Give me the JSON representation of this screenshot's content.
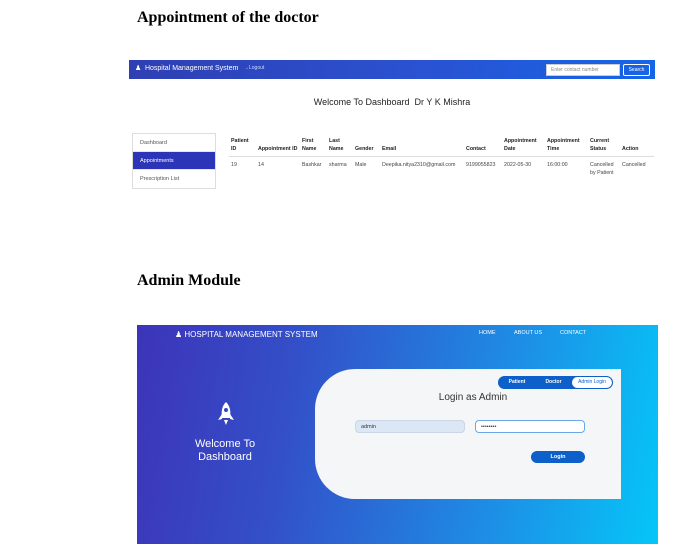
{
  "headings": {
    "doctor": "Appointment of the doctor",
    "admin": "Admin Module"
  },
  "doctor_dashboard": {
    "brand": "Hospital Management System",
    "logout": "Logout",
    "search_placeholder": "Enter contact number",
    "search_button": "Search",
    "welcome": "Welcome To Dashboard  Dr Y K Mishra",
    "sidebar": [
      {
        "label": "Dashboard",
        "active": false
      },
      {
        "label": "Appointments",
        "active": true
      },
      {
        "label": "Prescription List",
        "active": false
      }
    ],
    "table": {
      "headers": [
        "Patient ID",
        "Appointment ID",
        "First Name",
        "Last Name",
        "Gender",
        "Email",
        "Contact",
        "Appointment Date",
        "Appointment Time",
        "Current Status",
        "Action"
      ],
      "rows": [
        [
          "19",
          "14",
          "Bashkar",
          "sharma",
          "Male",
          "Deepika.nitya2310@gmail.com",
          "9199055823",
          "2022-05-30",
          "16:00:00",
          "Cancelled by Patient",
          "Cancelled"
        ]
      ]
    }
  },
  "admin_login": {
    "brand": "HOSPITAL MANAGEMENT SYSTEM",
    "nav": [
      "HOME",
      "ABOUT US",
      "CONTACT"
    ],
    "welcome": "Welcome To Dashboard",
    "tabs": [
      "Patient",
      "Doctor",
      "Admin Login"
    ],
    "selected_tab": "Admin Login",
    "title": "Login as Admin",
    "username_value": "admin",
    "password_value": "••••••••",
    "login_button": "Login",
    "colors": {
      "accent": "#0d5fc9",
      "gradient_start": "#3d34b8",
      "gradient_end": "#05c6f7"
    }
  }
}
